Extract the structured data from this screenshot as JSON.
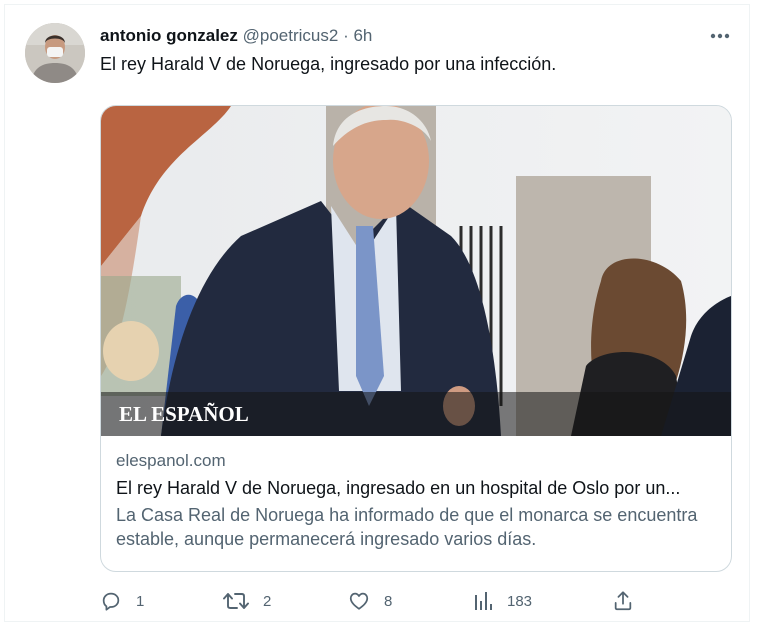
{
  "tweet": {
    "author_name": "antonio gonzalez",
    "handle": "@poetricus2",
    "separator": "·",
    "time": "6h",
    "text": "El rey Harald V de Noruega, ingresado por una infección.",
    "more_icon": "more-horizontal-icon"
  },
  "card": {
    "logo_text": "EL ESPAÑOL",
    "domain": "elespanol.com",
    "title": "El rey Harald V de Noruega, ingresado en un hospital de Oslo por un...",
    "description": "La Casa Real de Noruega ha informado de que el monarca se encuentra estable, aunque permanecerá ingresado varios días."
  },
  "actions": {
    "reply": {
      "icon": "reply-icon",
      "count": "1"
    },
    "retweet": {
      "icon": "retweet-icon",
      "count": "2"
    },
    "like": {
      "icon": "heart-icon",
      "count": "8"
    },
    "views": {
      "icon": "views-chart-icon",
      "count": "183"
    },
    "share": {
      "icon": "share-icon"
    }
  },
  "colors": {
    "text_primary": "#0f1419",
    "text_secondary": "#536471",
    "border": "#cfd9de"
  }
}
